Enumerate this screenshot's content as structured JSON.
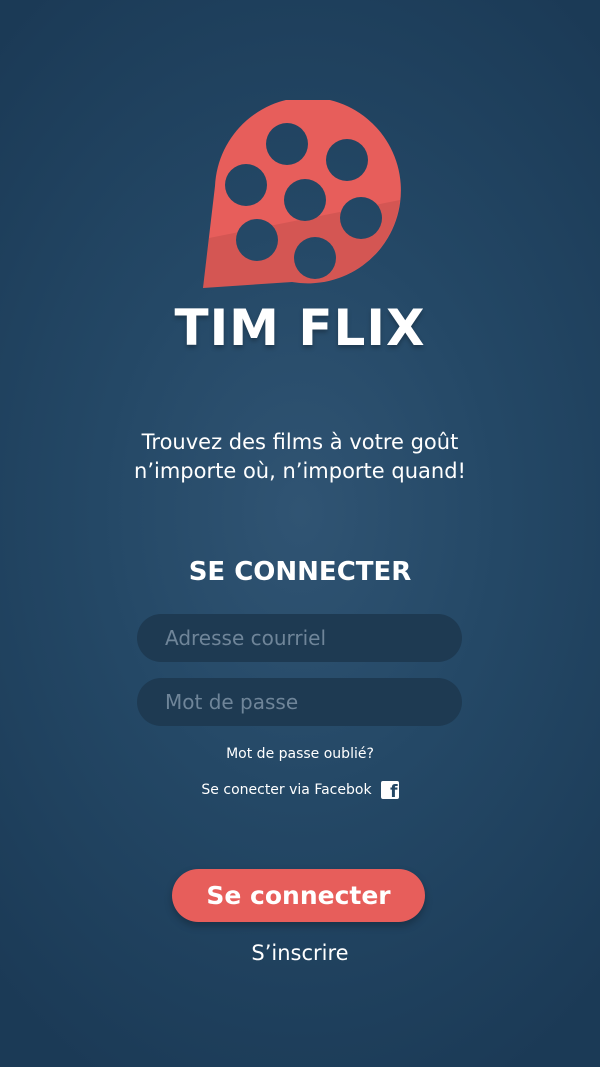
{
  "brand": {
    "name": "TIM FLIX",
    "logo_icon": "film-reel-pin-icon",
    "logo_color": "#e75e5b"
  },
  "tagline": {
    "line1": "Trouvez des films à votre goût",
    "line2": "n’importe où, n’importe quand!"
  },
  "login": {
    "heading": "SE CONNECTER",
    "email_placeholder": "Adresse courriel",
    "password_placeholder": "Mot de passe",
    "forgot_label": "Mot de passe oublié?",
    "facebook_label": "Se conecter via Facebok",
    "facebook_icon": "facebook-icon",
    "submit_label": "Se connecter",
    "signup_label": "S’inscrire"
  },
  "colors": {
    "background": "#244866",
    "accent": "#e75e5b",
    "input_bg": "#1e3a52"
  }
}
